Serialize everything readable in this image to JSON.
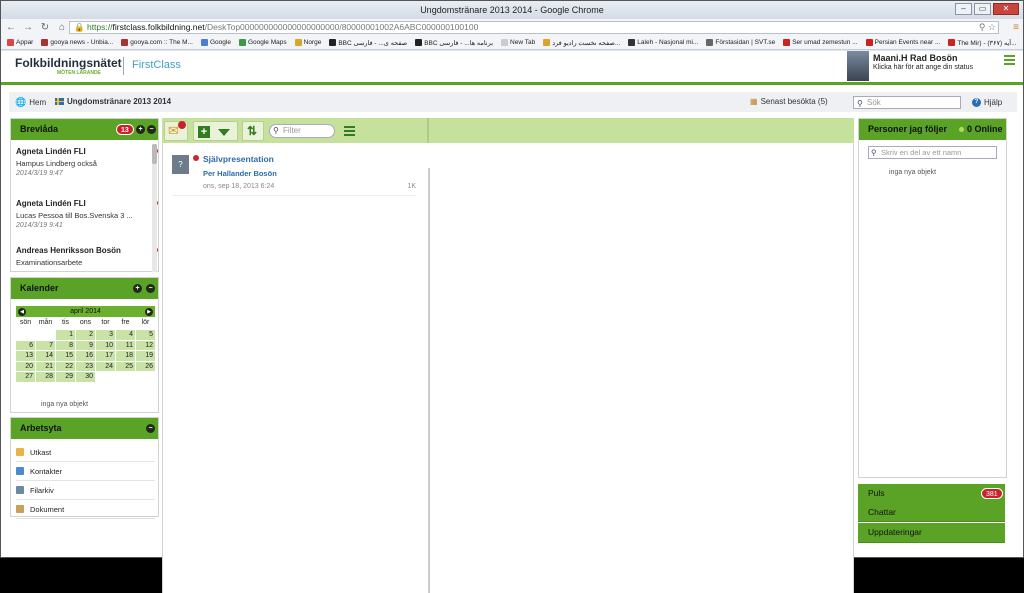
{
  "browser": {
    "window_title": "Ungdomstränare 2013 2014 - Google Chrome",
    "url_scheme": "https://",
    "url_host": "firstclass.folkbildning.net",
    "url_path": "/DeskTop000000000000000000000/80000001002A6ABC000000100100"
  },
  "bookmarks": [
    {
      "label": "Appar",
      "color": "#d44"
    },
    {
      "label": "gooya news - Unbia...",
      "color": "#a33"
    },
    {
      "label": "gooya.com :: The M...",
      "color": "#a33"
    },
    {
      "label": "Google",
      "color": "#4a7fd6"
    },
    {
      "label": "Google Maps",
      "color": "#3a9a4a"
    },
    {
      "label": "Norge",
      "color": "#d9a62a"
    },
    {
      "label": "BBC صفحه ی... - فارسی",
      "color": "#222"
    },
    {
      "label": "BBC برنامه ها... - فارسی",
      "color": "#222"
    },
    {
      "label": "New Tab",
      "color": "#ccc"
    },
    {
      "label": "صفحه نخست رادیو فرد...",
      "color": "#d9a62a"
    },
    {
      "label": "Laleh - Nasjonal mi...",
      "color": "#333"
    },
    {
      "label": "Förstasidan | SVT.se",
      "color": "#666"
    },
    {
      "label": "Ser umad zemestun ...",
      "color": "#c22"
    },
    {
      "label": "Persian Events near ...",
      "color": "#c22"
    },
    {
      "label": "The Mir) - (۳۶۷) آیه...",
      "color": "#c22"
    }
  ],
  "header": {
    "logo_main": "Folkbildningsnätet",
    "logo_sub": "MÖTEN LÄRANDE",
    "brand": "FirstClass",
    "user_name": "Maani.H Rad Bosön",
    "user_status": "Klicka här för att ange din status"
  },
  "crumbs": {
    "home": "Hem",
    "current": "Ungdomstränare 2013 2014",
    "recent": "Senast besökta (5)",
    "search_placeholder": "Sök",
    "help": "Hjälp"
  },
  "inbox": {
    "title": "Brevlåda",
    "badge": "13",
    "items": [
      {
        "from": "Agneta Lindén FLI",
        "subject": "Hampus Lindberg också",
        "date": "2014/3/19 9:47"
      },
      {
        "from": "Agneta Lindén FLI",
        "subject": "Lucas Pessoa till Bos.Svenska 3 ...",
        "date": "2014/3/19 9:41"
      },
      {
        "from": "Andreas Henriksson Bosön",
        "subject": "Examinationsarbete",
        "date": ""
      }
    ]
  },
  "calendar": {
    "title": "Kalender",
    "month": "april 2014",
    "weekdays": [
      "sön",
      "mån",
      "tis",
      "ons",
      "tor",
      "fre",
      "lör"
    ],
    "days": [
      "",
      "",
      "1",
      "2",
      "3",
      "4",
      "5",
      "6",
      "7",
      "8",
      "9",
      "10",
      "11",
      "12",
      "13",
      "14",
      "15",
      "16",
      "17",
      "18",
      "19",
      "20",
      "21",
      "22",
      "23",
      "24",
      "25",
      "26",
      "27",
      "28",
      "29",
      "30",
      "",
      "",
      ""
    ],
    "empty_text": "inga nya objekt"
  },
  "workspace": {
    "title": "Arbetsyta",
    "items": [
      {
        "label": "Utkast",
        "icon": "draft-icon",
        "color": "#e8b44a"
      },
      {
        "label": "Kontakter",
        "icon": "contacts-icon",
        "color": "#4a8ad0"
      },
      {
        "label": "Filarkiv",
        "icon": "file-archive-icon",
        "color": "#6a8aa0"
      },
      {
        "label": "Dokument",
        "icon": "document-icon",
        "color": "#c8a05a"
      }
    ]
  },
  "center": {
    "filter_placeholder": "Filter",
    "docs": [
      {
        "title": "Självpresentation",
        "author": "Per Hallander Bosön",
        "date": "ons, sep 18, 2013 6:24",
        "size": "1K"
      }
    ]
  },
  "people": {
    "title": "Personer jag följer",
    "online": "0 Online",
    "search_placeholder": "Skriv en del av ett namn",
    "empty_text": "inga nya objekt"
  },
  "bottom": {
    "pulse": "Puls",
    "pulse_badge": "381",
    "chats": "Chattar",
    "updates": "Uppdateringar"
  }
}
